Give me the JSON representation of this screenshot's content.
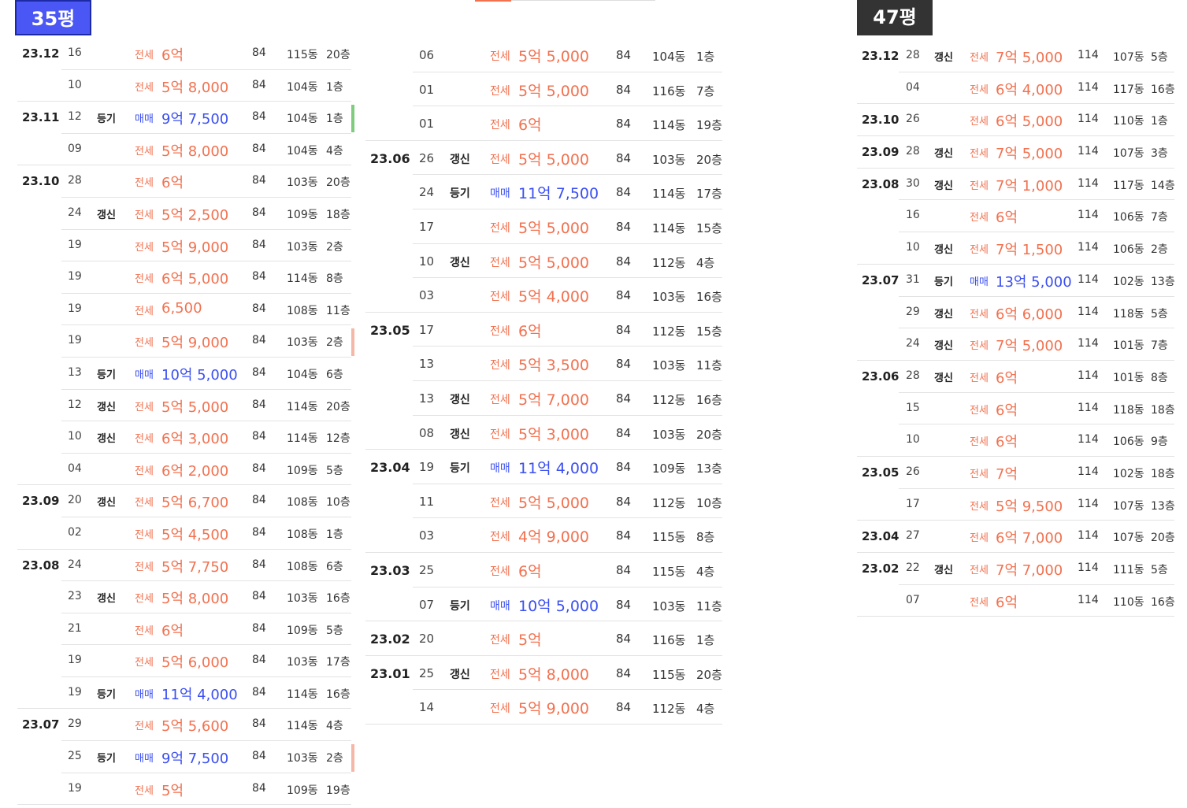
{
  "badges": {
    "left": "35평",
    "right": "47평"
  },
  "colors": {
    "lease": "#f2714f",
    "sale": "#3b4ff0",
    "badge_blue": "#4a57f5",
    "badge_dark": "#333333"
  },
  "col1": [
    {
      "date": "23.12",
      "day": "16",
      "tag": "",
      "type": "전세",
      "price": "6억",
      "area": "84",
      "dong": "115동",
      "floor": "20층",
      "kind": "lease"
    },
    {
      "date": "",
      "day": "10",
      "tag": "",
      "type": "전세",
      "price": "5억 8,000",
      "area": "84",
      "dong": "104동",
      "floor": "1층",
      "kind": "lease"
    },
    {
      "date": "23.11",
      "day": "12",
      "tag": "등기",
      "type": "매매",
      "price": "9억 7,500",
      "area": "84",
      "dong": "104동",
      "floor": "1층",
      "kind": "sale",
      "mark": "#7fcc7f"
    },
    {
      "date": "",
      "day": "09",
      "tag": "",
      "type": "전세",
      "price": "5억 8,000",
      "area": "84",
      "dong": "104동",
      "floor": "4층",
      "kind": "lease"
    },
    {
      "date": "23.10",
      "day": "28",
      "tag": "",
      "type": "전세",
      "price": "6억",
      "area": "84",
      "dong": "103동",
      "floor": "20층",
      "kind": "lease"
    },
    {
      "date": "",
      "day": "24",
      "tag": "갱신",
      "type": "전세",
      "price": "5억 2,500",
      "area": "84",
      "dong": "109동",
      "floor": "18층",
      "kind": "lease"
    },
    {
      "date": "",
      "day": "19",
      "tag": "",
      "type": "전세",
      "price": "5억 9,000",
      "area": "84",
      "dong": "103동",
      "floor": "2층",
      "kind": "lease"
    },
    {
      "date": "",
      "day": "19",
      "tag": "",
      "type": "전세",
      "price": "6억 5,000",
      "area": "84",
      "dong": "114동",
      "floor": "8층",
      "kind": "lease"
    },
    {
      "date": "",
      "day": "19",
      "tag": "",
      "type": "전세",
      "price": "6,500",
      "area": "84",
      "dong": "108동",
      "floor": "11층",
      "kind": "lease"
    },
    {
      "date": "",
      "day": "19",
      "tag": "",
      "type": "전세",
      "price": "5억 9,000",
      "area": "84",
      "dong": "103동",
      "floor": "2층",
      "kind": "lease",
      "mark": "#f5b7a6"
    },
    {
      "date": "",
      "day": "13",
      "tag": "등기",
      "type": "매매",
      "price": "10억 5,000",
      "area": "84",
      "dong": "104동",
      "floor": "6층",
      "kind": "sale"
    },
    {
      "date": "",
      "day": "12",
      "tag": "갱신",
      "type": "전세",
      "price": "5억 5,000",
      "area": "84",
      "dong": "114동",
      "floor": "20층",
      "kind": "lease"
    },
    {
      "date": "",
      "day": "10",
      "tag": "갱신",
      "type": "전세",
      "price": "6억 3,000",
      "area": "84",
      "dong": "114동",
      "floor": "12층",
      "kind": "lease"
    },
    {
      "date": "",
      "day": "04",
      "tag": "",
      "type": "전세",
      "price": "6억 2,000",
      "area": "84",
      "dong": "109동",
      "floor": "5층",
      "kind": "lease"
    },
    {
      "date": "23.09",
      "day": "20",
      "tag": "갱신",
      "type": "전세",
      "price": "5억 6,700",
      "area": "84",
      "dong": "108동",
      "floor": "10층",
      "kind": "lease"
    },
    {
      "date": "",
      "day": "02",
      "tag": "",
      "type": "전세",
      "price": "5억 4,500",
      "area": "84",
      "dong": "108동",
      "floor": "1층",
      "kind": "lease"
    },
    {
      "date": "23.08",
      "day": "24",
      "tag": "",
      "type": "전세",
      "price": "5억 7,750",
      "area": "84",
      "dong": "108동",
      "floor": "6층",
      "kind": "lease"
    },
    {
      "date": "",
      "day": "23",
      "tag": "갱신",
      "type": "전세",
      "price": "5억 8,000",
      "area": "84",
      "dong": "103동",
      "floor": "16층",
      "kind": "lease"
    },
    {
      "date": "",
      "day": "21",
      "tag": "",
      "type": "전세",
      "price": "6억",
      "area": "84",
      "dong": "109동",
      "floor": "5층",
      "kind": "lease"
    },
    {
      "date": "",
      "day": "19",
      "tag": "",
      "type": "전세",
      "price": "5억 6,000",
      "area": "84",
      "dong": "103동",
      "floor": "17층",
      "kind": "lease"
    },
    {
      "date": "",
      "day": "19",
      "tag": "등기",
      "type": "매매",
      "price": "11억 4,000",
      "area": "84",
      "dong": "114동",
      "floor": "16층",
      "kind": "sale"
    },
    {
      "date": "23.07",
      "day": "29",
      "tag": "",
      "type": "전세",
      "price": "5억 5,600",
      "area": "84",
      "dong": "114동",
      "floor": "4층",
      "kind": "lease"
    },
    {
      "date": "",
      "day": "25",
      "tag": "등기",
      "type": "매매",
      "price": "9억 7,500",
      "area": "84",
      "dong": "103동",
      "floor": "2층",
      "kind": "sale",
      "mark": "#f5b7a6"
    },
    {
      "date": "",
      "day": "19",
      "tag": "",
      "type": "전세",
      "price": "5억",
      "area": "84",
      "dong": "109동",
      "floor": "19층",
      "kind": "lease"
    }
  ],
  "col2": [
    {
      "date": "",
      "day": "06",
      "tag": "",
      "type": "전세",
      "price": "5억 5,000",
      "area": "84",
      "dong": "104동",
      "floor": "1층",
      "kind": "lease"
    },
    {
      "date": "",
      "day": "01",
      "tag": "",
      "type": "전세",
      "price": "5억 5,000",
      "area": "84",
      "dong": "116동",
      "floor": "7층",
      "kind": "lease"
    },
    {
      "date": "",
      "day": "01",
      "tag": "",
      "type": "전세",
      "price": "6억",
      "area": "84",
      "dong": "114동",
      "floor": "19층",
      "kind": "lease"
    },
    {
      "date": "23.06",
      "day": "26",
      "tag": "갱신",
      "type": "전세",
      "price": "5억 5,000",
      "area": "84",
      "dong": "103동",
      "floor": "20층",
      "kind": "lease"
    },
    {
      "date": "",
      "day": "24",
      "tag": "등기",
      "type": "매매",
      "price": "11억 7,500",
      "area": "84",
      "dong": "114동",
      "floor": "17층",
      "kind": "sale"
    },
    {
      "date": "",
      "day": "17",
      "tag": "",
      "type": "전세",
      "price": "5억 5,000",
      "area": "84",
      "dong": "114동",
      "floor": "15층",
      "kind": "lease"
    },
    {
      "date": "",
      "day": "10",
      "tag": "갱신",
      "type": "전세",
      "price": "5억 5,000",
      "area": "84",
      "dong": "112동",
      "floor": "4층",
      "kind": "lease"
    },
    {
      "date": "",
      "day": "03",
      "tag": "",
      "type": "전세",
      "price": "5억 4,000",
      "area": "84",
      "dong": "103동",
      "floor": "16층",
      "kind": "lease"
    },
    {
      "date": "23.05",
      "day": "17",
      "tag": "",
      "type": "전세",
      "price": "6억",
      "area": "84",
      "dong": "112동",
      "floor": "15층",
      "kind": "lease"
    },
    {
      "date": "",
      "day": "13",
      "tag": "",
      "type": "전세",
      "price": "5억 3,500",
      "area": "84",
      "dong": "103동",
      "floor": "11층",
      "kind": "lease"
    },
    {
      "date": "",
      "day": "13",
      "tag": "갱신",
      "type": "전세",
      "price": "5억 7,000",
      "area": "84",
      "dong": "112동",
      "floor": "16층",
      "kind": "lease"
    },
    {
      "date": "",
      "day": "08",
      "tag": "갱신",
      "type": "전세",
      "price": "5억 3,000",
      "area": "84",
      "dong": "103동",
      "floor": "20층",
      "kind": "lease"
    },
    {
      "date": "23.04",
      "day": "19",
      "tag": "등기",
      "type": "매매",
      "price": "11억 4,000",
      "area": "84",
      "dong": "109동",
      "floor": "13층",
      "kind": "sale"
    },
    {
      "date": "",
      "day": "11",
      "tag": "",
      "type": "전세",
      "price": "5억 5,000",
      "area": "84",
      "dong": "112동",
      "floor": "10층",
      "kind": "lease"
    },
    {
      "date": "",
      "day": "03",
      "tag": "",
      "type": "전세",
      "price": "4억 9,000",
      "area": "84",
      "dong": "115동",
      "floor": "8층",
      "kind": "lease"
    },
    {
      "date": "23.03",
      "day": "25",
      "tag": "",
      "type": "전세",
      "price": "6억",
      "area": "84",
      "dong": "115동",
      "floor": "4층",
      "kind": "lease"
    },
    {
      "date": "",
      "day": "07",
      "tag": "등기",
      "type": "매매",
      "price": "10억 5,000",
      "area": "84",
      "dong": "103동",
      "floor": "11층",
      "kind": "sale"
    },
    {
      "date": "23.02",
      "day": "20",
      "tag": "",
      "type": "전세",
      "price": "5억",
      "area": "84",
      "dong": "116동",
      "floor": "1층",
      "kind": "lease"
    },
    {
      "date": "23.01",
      "day": "25",
      "tag": "갱신",
      "type": "전세",
      "price": "5억 8,000",
      "area": "84",
      "dong": "115동",
      "floor": "20층",
      "kind": "lease"
    },
    {
      "date": "",
      "day": "14",
      "tag": "",
      "type": "전세",
      "price": "5억 9,000",
      "area": "84",
      "dong": "112동",
      "floor": "4층",
      "kind": "lease"
    }
  ],
  "col3": [
    {
      "date": "23.12",
      "day": "28",
      "tag": "갱신",
      "type": "전세",
      "price": "7억 5,000",
      "area": "114",
      "dong": "107동",
      "floor": "5층",
      "kind": "lease"
    },
    {
      "date": "",
      "day": "04",
      "tag": "",
      "type": "전세",
      "price": "6억 4,000",
      "area": "114",
      "dong": "117동",
      "floor": "16층",
      "kind": "lease"
    },
    {
      "date": "23.10",
      "day": "26",
      "tag": "",
      "type": "전세",
      "price": "6억 5,000",
      "area": "114",
      "dong": "110동",
      "floor": "1층",
      "kind": "lease"
    },
    {
      "date": "23.09",
      "day": "28",
      "tag": "갱신",
      "type": "전세",
      "price": "7억 5,000",
      "area": "114",
      "dong": "107동",
      "floor": "3층",
      "kind": "lease"
    },
    {
      "date": "23.08",
      "day": "30",
      "tag": "갱신",
      "type": "전세",
      "price": "7억 1,000",
      "area": "114",
      "dong": "117동",
      "floor": "14층",
      "kind": "lease"
    },
    {
      "date": "",
      "day": "16",
      "tag": "",
      "type": "전세",
      "price": "6억",
      "area": "114",
      "dong": "106동",
      "floor": "7층",
      "kind": "lease"
    },
    {
      "date": "",
      "day": "10",
      "tag": "갱신",
      "type": "전세",
      "price": "7억 1,500",
      "area": "114",
      "dong": "106동",
      "floor": "2층",
      "kind": "lease"
    },
    {
      "date": "23.07",
      "day": "31",
      "tag": "등기",
      "type": "매매",
      "price": "13억 5,000",
      "area": "114",
      "dong": "102동",
      "floor": "13층",
      "kind": "sale"
    },
    {
      "date": "",
      "day": "29",
      "tag": "갱신",
      "type": "전세",
      "price": "6억 6,000",
      "area": "114",
      "dong": "118동",
      "floor": "5층",
      "kind": "lease"
    },
    {
      "date": "",
      "day": "24",
      "tag": "갱신",
      "type": "전세",
      "price": "7억 5,000",
      "area": "114",
      "dong": "101동",
      "floor": "7층",
      "kind": "lease"
    },
    {
      "date": "23.06",
      "day": "28",
      "tag": "갱신",
      "type": "전세",
      "price": "6억",
      "area": "114",
      "dong": "101동",
      "floor": "8층",
      "kind": "lease"
    },
    {
      "date": "",
      "day": "15",
      "tag": "",
      "type": "전세",
      "price": "6억",
      "area": "114",
      "dong": "118동",
      "floor": "18층",
      "kind": "lease"
    },
    {
      "date": "",
      "day": "10",
      "tag": "",
      "type": "전세",
      "price": "6억",
      "area": "114",
      "dong": "106동",
      "floor": "9층",
      "kind": "lease"
    },
    {
      "date": "23.05",
      "day": "26",
      "tag": "",
      "type": "전세",
      "price": "7억",
      "area": "114",
      "dong": "102동",
      "floor": "18층",
      "kind": "lease"
    },
    {
      "date": "",
      "day": "17",
      "tag": "",
      "type": "전세",
      "price": "5억 9,500",
      "area": "114",
      "dong": "107동",
      "floor": "13층",
      "kind": "lease"
    },
    {
      "date": "23.04",
      "day": "27",
      "tag": "",
      "type": "전세",
      "price": "6억 7,000",
      "area": "114",
      "dong": "107동",
      "floor": "20층",
      "kind": "lease"
    },
    {
      "date": "23.02",
      "day": "22",
      "tag": "갱신",
      "type": "전세",
      "price": "7억 7,000",
      "area": "114",
      "dong": "111동",
      "floor": "5층",
      "kind": "lease"
    },
    {
      "date": "",
      "day": "07",
      "tag": "",
      "type": "전세",
      "price": "6억",
      "area": "114",
      "dong": "110동",
      "floor": "16층",
      "kind": "lease"
    }
  ]
}
